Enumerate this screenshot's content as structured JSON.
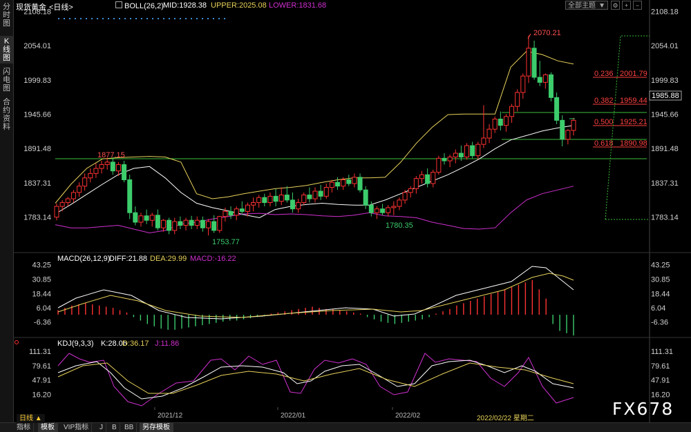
{
  "sidebar": {
    "tabs": [
      "分时图",
      "K线图",
      "闪电图",
      "合约资料"
    ]
  },
  "header": {
    "symbol": "现货黄金",
    "period": "<日线>",
    "boll_name": "BOLL(26,2)",
    "mid": "MID:1928.38",
    "upper": "UPPER:2025.08",
    "lower": "LOWER:1831.68",
    "theme_button": "全部主题"
  },
  "macd_header": {
    "name": "MACD(26,12,9)",
    "diff": "DIFF:21.88",
    "dea": "DEA:29.99",
    "macd": "MACD:-16.22"
  },
  "kdj_header": {
    "name": "KDJ(9,3,3)",
    "k": "K:28.06",
    "d": "D:36.17",
    "j": "J:11.86"
  },
  "price_axis": [
    "2108.18",
    "2054.01",
    "1999.83",
    "1945.66",
    "1891.48",
    "1837.31",
    "1783.14"
  ],
  "current_price": "1985.88",
  "macd_axis": [
    "43.25",
    "30.85",
    "18.44",
    "6.04",
    "-6.36"
  ],
  "kdj_axis": [
    "111.31",
    "79.61",
    "47.91",
    "16.20"
  ],
  "annotations": {
    "high": "2070.21",
    "p1877": "1877.15",
    "low1": "1753.77",
    "low2": "1780.35"
  },
  "fib": [
    {
      "ratio": "0.236",
      "value": "2001.79"
    },
    {
      "ratio": "0.382",
      "value": "1959.44"
    },
    {
      "ratio": "0.500",
      "value": "1925.21"
    },
    {
      "ratio": "0.618",
      "value": "1890.98"
    }
  ],
  "dates": [
    "2021/12",
    "2022/01",
    "2022/02",
    "2022/02/22 星期二"
  ],
  "bottom_tabs": [
    "日线 ▲",
    "指标",
    "模板",
    "VIP指标",
    "J",
    "B",
    "BB",
    "另存模板"
  ],
  "watermark": "FX678",
  "colors": {
    "up": "#ff3232",
    "down": "#3ccc6c",
    "mid": "#ffffff",
    "upper": "#e8d25a",
    "lower": "#d030d0",
    "fib": "#ff4040",
    "hline": "#3cbf3c"
  },
  "chart_data": {
    "type": "candlestick",
    "title": "现货黄金 日线",
    "ylim": [
      1740,
      2115
    ],
    "candles": [
      [
        1783,
        1805,
        1778,
        1800
      ],
      [
        1800,
        1810,
        1792,
        1806
      ],
      [
        1806,
        1815,
        1800,
        1812
      ],
      [
        1812,
        1826,
        1806,
        1822
      ],
      [
        1822,
        1838,
        1815,
        1832
      ],
      [
        1832,
        1852,
        1825,
        1845
      ],
      [
        1845,
        1860,
        1838,
        1852
      ],
      [
        1852,
        1868,
        1845,
        1860
      ],
      [
        1860,
        1872,
        1852,
        1866
      ],
      [
        1866,
        1877,
        1858,
        1870
      ],
      [
        1870,
        1877,
        1850,
        1856
      ],
      [
        1856,
        1870,
        1848,
        1866
      ],
      [
        1866,
        1872,
        1838,
        1842
      ],
      [
        1842,
        1850,
        1780,
        1790
      ],
      [
        1790,
        1800,
        1770,
        1775
      ],
      [
        1775,
        1790,
        1768,
        1785
      ],
      [
        1785,
        1795,
        1772,
        1778
      ],
      [
        1778,
        1790,
        1768,
        1786
      ],
      [
        1786,
        1795,
        1762,
        1766
      ],
      [
        1766,
        1780,
        1760,
        1778
      ],
      [
        1778,
        1782,
        1756,
        1762
      ],
      [
        1762,
        1782,
        1756,
        1776
      ],
      [
        1776,
        1784,
        1764,
        1770
      ],
      [
        1770,
        1782,
        1762,
        1778
      ],
      [
        1778,
        1785,
        1764,
        1770
      ],
      [
        1770,
        1784,
        1764,
        1778
      ],
      [
        1778,
        1784,
        1760,
        1766
      ],
      [
        1766,
        1780,
        1754,
        1776
      ],
      [
        1776,
        1786,
        1758,
        1762
      ],
      [
        1762,
        1785,
        1758,
        1784
      ],
      [
        1784,
        1798,
        1776,
        1792
      ],
      [
        1792,
        1800,
        1780,
        1786
      ],
      [
        1786,
        1800,
        1778,
        1796
      ],
      [
        1796,
        1808,
        1786,
        1792
      ],
      [
        1792,
        1806,
        1784,
        1802
      ],
      [
        1802,
        1814,
        1792,
        1806
      ],
      [
        1806,
        1818,
        1798,
        1814
      ],
      [
        1814,
        1820,
        1800,
        1806
      ],
      [
        1806,
        1822,
        1800,
        1816
      ],
      [
        1816,
        1828,
        1800,
        1808
      ],
      [
        1808,
        1830,
        1802,
        1818
      ],
      [
        1818,
        1832,
        1806,
        1810
      ],
      [
        1810,
        1822,
        1790,
        1796
      ],
      [
        1796,
        1812,
        1790,
        1806
      ],
      [
        1806,
        1822,
        1802,
        1818
      ],
      [
        1818,
        1830,
        1806,
        1812
      ],
      [
        1812,
        1830,
        1806,
        1824
      ],
      [
        1824,
        1834,
        1810,
        1816
      ],
      [
        1816,
        1836,
        1812,
        1830
      ],
      [
        1830,
        1842,
        1822,
        1838
      ],
      [
        1838,
        1846,
        1826,
        1832
      ],
      [
        1832,
        1846,
        1826,
        1842
      ],
      [
        1842,
        1850,
        1832,
        1836
      ],
      [
        1836,
        1852,
        1830,
        1846
      ],
      [
        1846,
        1852,
        1822,
        1826
      ],
      [
        1826,
        1832,
        1796,
        1802
      ],
      [
        1802,
        1808,
        1784,
        1790
      ],
      [
        1790,
        1800,
        1780,
        1796
      ],
      [
        1796,
        1804,
        1786,
        1790
      ],
      [
        1790,
        1802,
        1784,
        1798
      ],
      [
        1798,
        1808,
        1786,
        1800
      ],
      [
        1800,
        1814,
        1794,
        1810
      ],
      [
        1810,
        1826,
        1804,
        1822
      ],
      [
        1822,
        1832,
        1814,
        1828
      ],
      [
        1828,
        1848,
        1820,
        1844
      ],
      [
        1844,
        1856,
        1836,
        1850
      ],
      [
        1850,
        1860,
        1830,
        1836
      ],
      [
        1836,
        1858,
        1830,
        1854
      ],
      [
        1854,
        1880,
        1850,
        1876
      ],
      [
        1876,
        1884,
        1866,
        1872
      ],
      [
        1872,
        1882,
        1862,
        1878
      ],
      [
        1878,
        1890,
        1868,
        1884
      ],
      [
        1884,
        1896,
        1872,
        1878
      ],
      [
        1878,
        1900,
        1874,
        1896
      ],
      [
        1896,
        1902,
        1876,
        1880
      ],
      [
        1880,
        1902,
        1874,
        1898
      ],
      [
        1898,
        1960,
        1892,
        1908
      ],
      [
        1908,
        1930,
        1900,
        1922
      ],
      [
        1922,
        1942,
        1916,
        1938
      ],
      [
        1938,
        1950,
        1920,
        1928
      ],
      [
        1928,
        1946,
        1918,
        1942
      ],
      [
        1942,
        1962,
        1932,
        1958
      ],
      [
        1958,
        1985,
        1950,
        1980
      ],
      [
        1980,
        2010,
        1970,
        2006
      ],
      [
        2006,
        2070,
        1995,
        2050
      ],
      [
        2050,
        2062,
        2000,
        2004
      ],
      [
        2004,
        2030,
        1990,
        1996
      ],
      [
        1996,
        2010,
        1986,
        2008
      ],
      [
        2008,
        2012,
        1966,
        1972
      ],
      [
        1972,
        1980,
        1930,
        1936
      ],
      [
        1936,
        1944,
        1895,
        1906
      ],
      [
        1906,
        1922,
        1898,
        1920
      ],
      [
        1920,
        1940,
        1912,
        1936
      ]
    ],
    "series": [
      {
        "name": "MID",
        "values": [
          1788,
          1803,
          1819,
          1835,
          1850,
          1860,
          1863,
          1845,
          1822,
          1805,
          1798,
          1793,
          1787,
          1782,
          1795,
          1800,
          1803,
          1805,
          1803,
          1802,
          1802,
          1810,
          1820,
          1830,
          1840,
          1850,
          1862,
          1875,
          1891,
          1905,
          1912,
          1919,
          1924,
          1928
        ]
      },
      {
        "name": "UPPER",
        "values": [
          1805,
          1835,
          1860,
          1875,
          1877,
          1878,
          1879,
          1878,
          1870,
          1820,
          1812,
          1815,
          1820,
          1824,
          1828,
          1830,
          1833,
          1838,
          1842,
          1845,
          1845,
          1846,
          1870,
          1900,
          1925,
          1945,
          1946,
          1946,
          1946,
          2020,
          2045,
          2040,
          2030,
          2025
        ]
      },
      {
        "name": "LOWER",
        "values": [
          1771,
          1766,
          1766,
          1768,
          1770,
          1764,
          1758,
          1762,
          1772,
          1775,
          1780,
          1784,
          1788,
          1789,
          1787,
          1788,
          1787,
          1785,
          1784,
          1786,
          1790,
          1785,
          1784,
          1782,
          1775,
          1770,
          1765,
          1764,
          1766,
          1790,
          1810,
          1820,
          1826,
          1832
        ]
      }
    ]
  }
}
